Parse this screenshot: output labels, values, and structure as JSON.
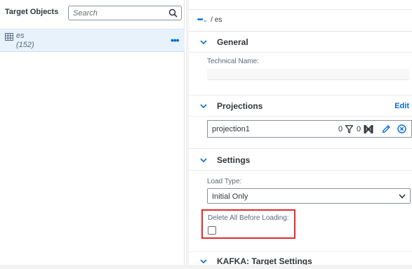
{
  "left_panel": {
    "title": "Target Objects",
    "search": {
      "placeholder": "Search",
      "value": ""
    },
    "objects": [
      {
        "name": "es",
        "count": "(152)",
        "more_label": "•••",
        "icon": "table-icon"
      }
    ]
  },
  "right_panel": {
    "breadcrumb": {
      "more": "•••",
      "chevron": "⌄",
      "separator": "/",
      "current": "es"
    },
    "sections": {
      "general": {
        "title": "General",
        "technical_name_label": "Technical Name:",
        "technical_name_value": ""
      },
      "projections": {
        "title": "Projections",
        "edit_label": "Edit",
        "items": [
          {
            "name": "projection1",
            "filter_count": "0",
            "mapping_count": "0"
          }
        ]
      },
      "settings": {
        "title": "Settings",
        "load_type_label": "Load Type:",
        "load_type_value": "Initial Only",
        "delete_all_label": "Delete All Before Loading:",
        "delete_all_checked": false
      },
      "kafka": {
        "title": "KAFKA: Target Settings"
      }
    }
  },
  "colors": {
    "accent": "#0a6ed1",
    "selected_row": "#e8f2fb",
    "highlight_border": "#e32a2a",
    "text": "#32363a"
  }
}
